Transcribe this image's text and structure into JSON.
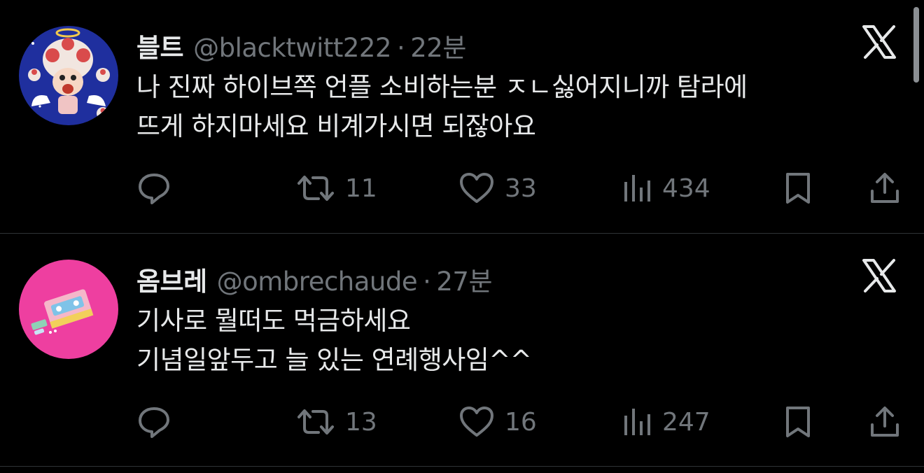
{
  "tweets": [
    {
      "name": "블트",
      "handle": "@blacktwitt222",
      "dot": "·",
      "time": "22분",
      "text": [
        "나 진짜 하이브쪽 언플 소비하는분 ㅈㄴ싫어지니까 탐라에",
        "뜨게 하지마세요 비계가시면 되잖아요"
      ],
      "retweets": "11",
      "likes": "33",
      "views": "434",
      "avatar_icon": "toad-character-avatar"
    },
    {
      "name": "옴브레",
      "handle": "@ombrechaude",
      "dot": "·",
      "time": "27분",
      "text": [
        "기사로 뭘떠도 먹금하세요",
        "기념일앞두고 늘 있는 연례행사임^^"
      ],
      "retweets": "13",
      "likes": "16",
      "views": "247",
      "avatar_icon": "pink-cassette-avatar"
    }
  ],
  "icons": {
    "reply": "reply-icon",
    "retweet": "retweet-icon",
    "like": "heart-icon",
    "views": "views-icon",
    "bookmark": "bookmark-icon",
    "share": "share-icon",
    "logo": "x-logo-icon"
  },
  "colors": {
    "background": "#000000",
    "text": "#e7e9ea",
    "muted": "#71767b",
    "divider": "#2f3336"
  }
}
